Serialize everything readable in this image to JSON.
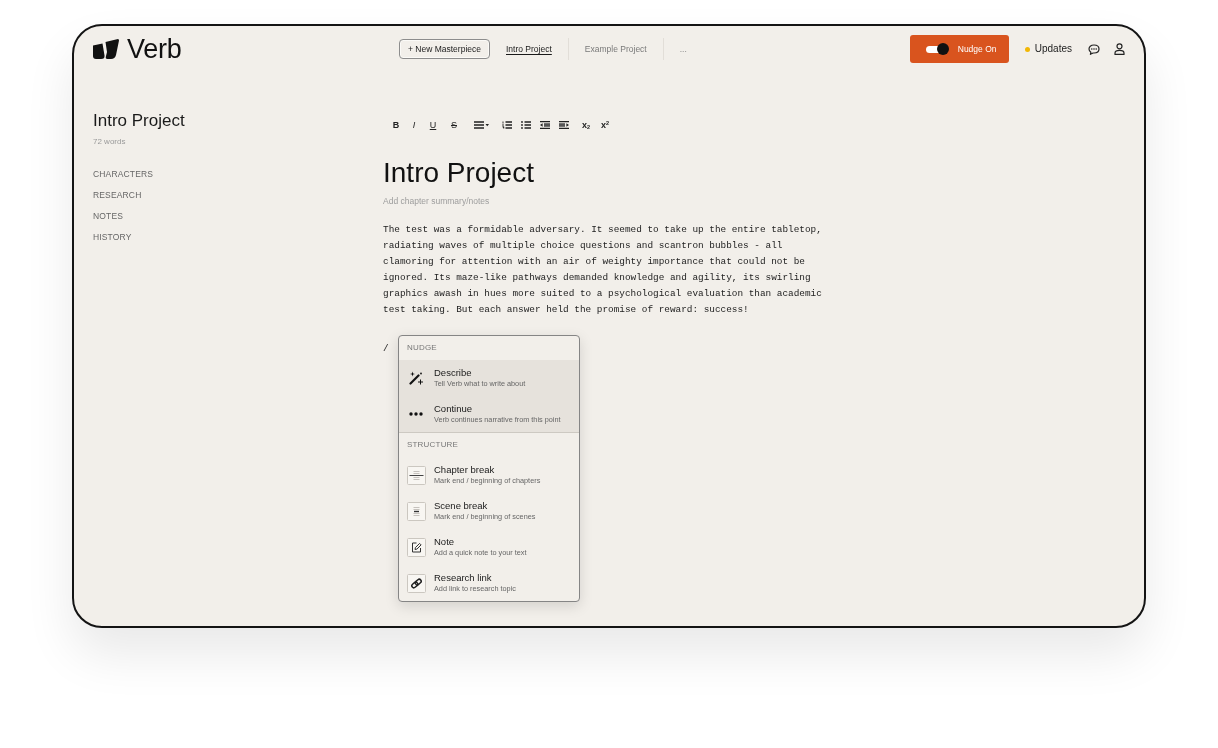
{
  "app": {
    "logo": "Verb"
  },
  "nav": {
    "new_button": "+ New Masterpiece",
    "tabs": [
      {
        "label": "Intro Project",
        "selected": true
      },
      {
        "label": "Example Project",
        "selected": false
      }
    ],
    "more": "..."
  },
  "nudge": {
    "label": "Nudge On",
    "on": true
  },
  "updates": {
    "label": "Updates",
    "unread": true
  },
  "sidebar": {
    "title": "Intro Project",
    "word_count": "72 words",
    "items": [
      "CHARACTERS",
      "RESEARCH",
      "NOTES",
      "HISTORY"
    ]
  },
  "toolbar": [
    {
      "kind": "bold",
      "label": "B"
    },
    {
      "kind": "italic",
      "label": "I"
    },
    {
      "kind": "underline",
      "label": "U"
    },
    {
      "kind": "strike",
      "label": "S"
    },
    {
      "kind": "align"
    },
    {
      "kind": "ordered_list"
    },
    {
      "kind": "bullet_list"
    },
    {
      "kind": "outdent"
    },
    {
      "kind": "indent"
    },
    {
      "kind": "subscript",
      "label": "x$_{2}$"
    },
    {
      "kind": "superscript",
      "label": "x$^{2}$"
    }
  ],
  "document": {
    "title": "Intro Project",
    "summary": {
      "placeholder": "Add chapter summary/notes"
    },
    "body": "The test was a formidable adversary. It seemed to take up the entire tabletop, radiating waves of multiple choice questions and scantron bubbles - all clamoring for attention with an air of weighty importance that could not be ignored. Its maze-like pathways demanded knowledge and agility, its swirling graphics awash in hues more suited to a psychological evaluation than academic test taking. But each answer held the promise of reward: success!",
    "command": "/"
  },
  "command_menu": {
    "sections": [
      {
        "kind": "nudge",
        "title": "NUDGE",
        "items": [
          {
            "title": "Describe",
            "description": "Tell Verb what to write about"
          },
          {
            "title": "Continue",
            "description": "Verb continues narrative from this point"
          }
        ]
      },
      {
        "kind": "structure",
        "title": "STRUCTURE",
        "items": [
          {
            "title": "Chapter break",
            "description": "Mark end / beginning of chapters"
          },
          {
            "title": "Scene break",
            "description": "Mark end / beginning of scenes"
          },
          {
            "title": "Note",
            "description": "Add a quick note to your text"
          },
          {
            "title": "Research link",
            "description": "Add link to research topic"
          }
        ]
      }
    ]
  }
}
